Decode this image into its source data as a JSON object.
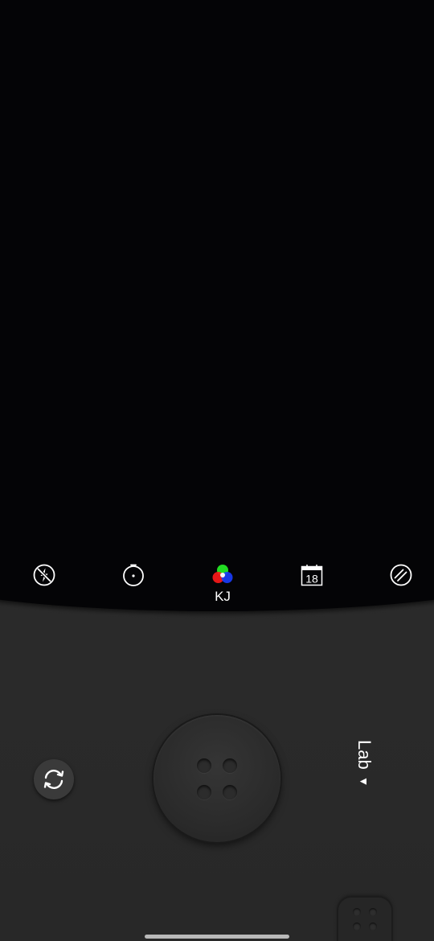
{
  "toolbar": {
    "flash_icon": "flash-off-icon",
    "timer_icon": "timer-icon",
    "filter_icon": "rgb-filter-icon",
    "filter_label": "KJ",
    "date_icon": "calendar-date-icon",
    "date_value": "18",
    "effect_icon": "light-leak-icon"
  },
  "controls": {
    "flip_icon": "camera-flip-icon",
    "shutter_icon": "shutter-button",
    "lab_label": "Lab",
    "lab_arrow": "▼"
  },
  "colors": {
    "viewfinder": "#040406",
    "body": "#2b2b2b",
    "icon": "#ffffff",
    "rgb_red": "#ff1a1a",
    "rgb_green": "#22dd22",
    "rgb_blue": "#1a3dff"
  }
}
